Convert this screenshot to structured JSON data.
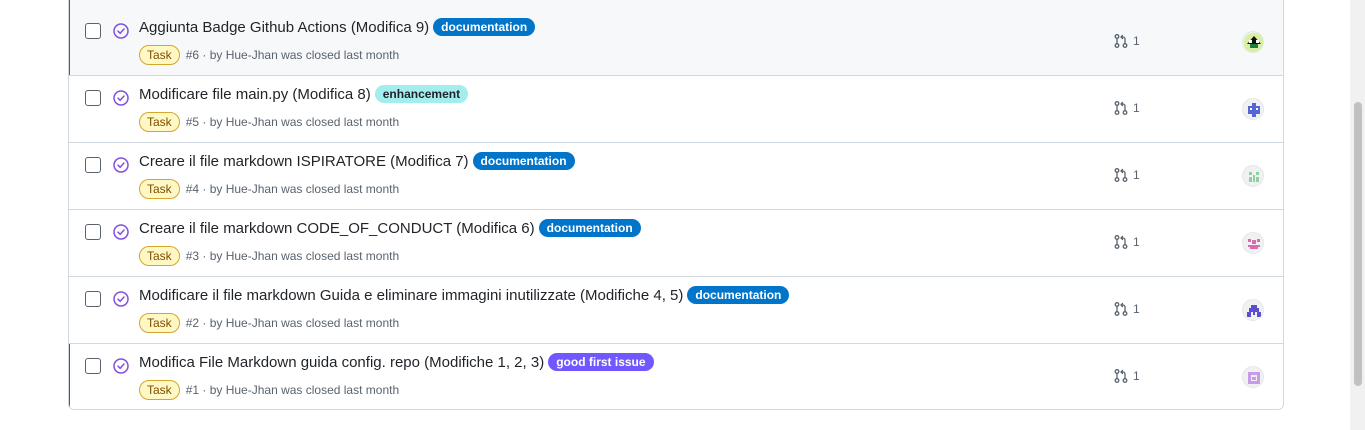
{
  "issues": [
    {
      "title": "Aggiunta Badge Github Actions (Modifica 9)",
      "label": "documentation",
      "label_bg": "#0075ca",
      "label_fg": "#ffffff",
      "type": "Task",
      "meta": "#6 · by Hue-Jhan was closed last month",
      "pr_count": "1",
      "avatar_color": "#1a7f37",
      "highlight": true
    },
    {
      "title": "Modificare file main.py (Modifica 8)",
      "label": "enhancement",
      "label_bg": "#a2eeef",
      "label_fg": "#1f2328",
      "type": "Task",
      "meta": "#5 · by Hue-Jhan was closed last month",
      "pr_count": "1",
      "avatar_color": "#5465d6"
    },
    {
      "title": "Creare il file markdown ISPIRATORE (Modifica 7)",
      "label": "documentation",
      "label_bg": "#0075ca",
      "label_fg": "#ffffff",
      "type": "Task",
      "meta": "#4 · by Hue-Jhan was closed last month",
      "pr_count": "1",
      "avatar_color": "#8fd19e"
    },
    {
      "title": "Creare il file markdown CODE_OF_CONDUCT (Modifica 6)",
      "label": "documentation",
      "label_bg": "#0075ca",
      "label_fg": "#ffffff",
      "type": "Task",
      "meta": "#3 · by Hue-Jhan was closed last month",
      "pr_count": "1",
      "avatar_color": "#d96cb0"
    },
    {
      "title": "Modificare il file markdown Guida e eliminare immagini inutilizzate (Modifiche 4, 5)",
      "label": "documentation",
      "label_bg": "#0075ca",
      "label_fg": "#ffffff",
      "type": "Task",
      "meta": "#2 · by Hue-Jhan was closed last month",
      "pr_count": "1",
      "avatar_color": "#5b4fcf"
    },
    {
      "title": "Modifica File Markdown guida config. repo (Modifiche 1, 2, 3)",
      "label": "good first issue",
      "label_bg": "#7057ff",
      "label_fg": "#ffffff",
      "type": "Task",
      "meta": "#1 · by Hue-Jhan was closed last month",
      "pr_count": "1",
      "avatar_color": "#c79be8",
      "focused": true
    }
  ],
  "colors": {
    "closed_purple": "#8250df",
    "accent": "#0969da"
  }
}
